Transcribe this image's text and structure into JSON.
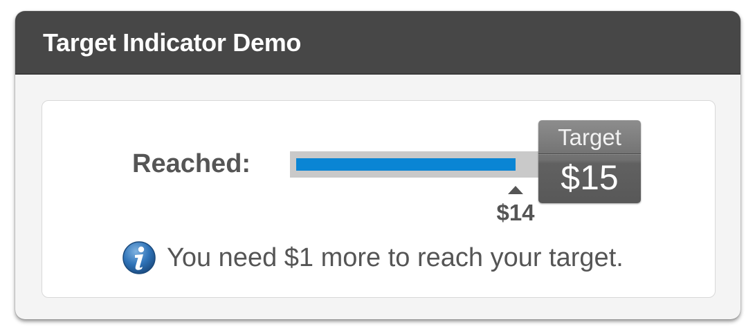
{
  "panel": {
    "title": "Target Indicator Demo"
  },
  "indicator": {
    "reached_label": "Reached:",
    "current_value": "$14",
    "target_label": "Target",
    "target_value": "$15",
    "progress_fraction": 0.9333,
    "fill_color": "#0a85d4",
    "track_color": "#c9c9c9"
  },
  "info": {
    "icon": "info-icon",
    "message": "You need $1 more to reach your target."
  }
}
